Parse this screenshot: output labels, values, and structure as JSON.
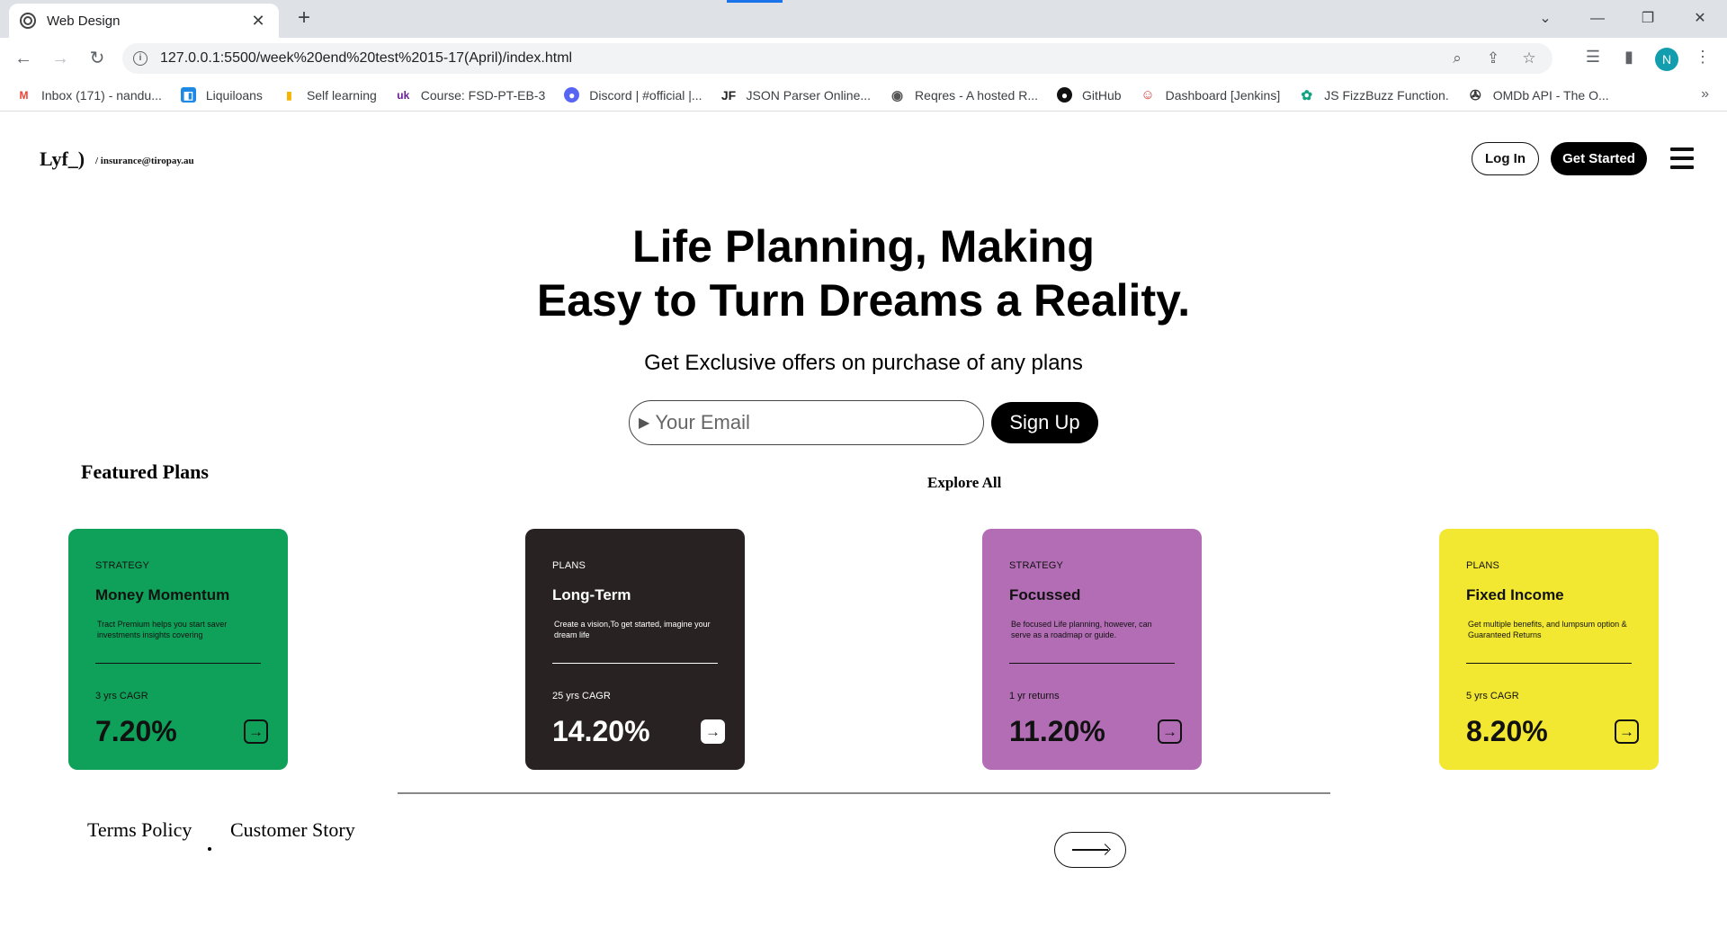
{
  "browser": {
    "tab_title": "Web Design",
    "tab_close": "✕",
    "new_tab": "+",
    "url": "127.0.0.1:5500/week%20end%20test%2015-17(April)/index.html",
    "profile_initial": "N",
    "accent_color": "#1a73e8",
    "bookmarks": [
      {
        "label": "Inbox (171) - nandu...",
        "icon": "gmail-icon",
        "color": "#ea4335"
      },
      {
        "label": "Liquiloans",
        "icon": "liquiloans-icon",
        "color": "#1e88e5"
      },
      {
        "label": "Self learning",
        "icon": "bars-icon",
        "color": "#f4b400"
      },
      {
        "label": "Course: FSD-PT-EB-3",
        "icon": "course-icon",
        "color": "#6a1b9a"
      },
      {
        "label": "Discord | #official |...",
        "icon": "discord-icon",
        "color": "#5865f2"
      },
      {
        "label": "JSON Parser Online...",
        "icon": "jf-icon",
        "color": "#222222"
      },
      {
        "label": "Reqres - A hosted R...",
        "icon": "globe-icon",
        "color": "#555555"
      },
      {
        "label": "GitHub",
        "icon": "github-icon",
        "color": "#111111"
      },
      {
        "label": "Dashboard [Jenkins]",
        "icon": "jenkins-icon",
        "color": "#d33833"
      },
      {
        "label": "JS FizzBuzz Function.",
        "icon": "openai-icon",
        "color": "#10a37f"
      },
      {
        "label": "OMDb API - The O...",
        "icon": "film-icon",
        "color": "#333333"
      }
    ]
  },
  "header": {
    "logo": "Lyf_)",
    "logo_email": "/ insurance@tiropay.au",
    "login_label": "Log In",
    "get_started_label": "Get Started"
  },
  "hero": {
    "title_line1": "Life Planning, Making",
    "title_line2": "Easy to Turn Dreams a Reality.",
    "subtitle": "Get Exclusive offers on purchase of any plans",
    "email_placeholder": "Your Email",
    "signup_label": "Sign Up"
  },
  "plans": {
    "heading": "Featured Plans",
    "explore_label": "Explore All",
    "cards": [
      {
        "kicker": "STRATEGY",
        "name": "Money Momentum",
        "desc": "Tract Premium helps you start saver investments insights covering",
        "metric": "3 yrs CAGR",
        "value": "7.20%",
        "bg": "#0fa15a",
        "fg": "#111111"
      },
      {
        "kicker": "PLANS",
        "name": "Long-Term",
        "desc": "Create a vision,To get started, imagine your dream life",
        "metric": "25 yrs CAGR",
        "value": "14.20%",
        "bg": "#282322",
        "fg": "#ffffff"
      },
      {
        "kicker": "STRATEGY",
        "name": "Focussed",
        "desc": "Be focused Life planning, however, can serve as a roadmap or guide.",
        "metric": "1 yr returns",
        "value": "11.20%",
        "bg": "#b26db5",
        "fg": "#111111"
      },
      {
        "kicker": "PLANS",
        "name": "Fixed Income",
        "desc": "Get multiple benefits, and lumpsum option & Guaranteed Returns",
        "metric": "5 yrs CAGR",
        "value": "8.20%",
        "bg": "#f2e731",
        "fg": "#111111"
      }
    ]
  },
  "footer": {
    "terms_label": "Terms Policy",
    "story_label": "Customer Story"
  }
}
